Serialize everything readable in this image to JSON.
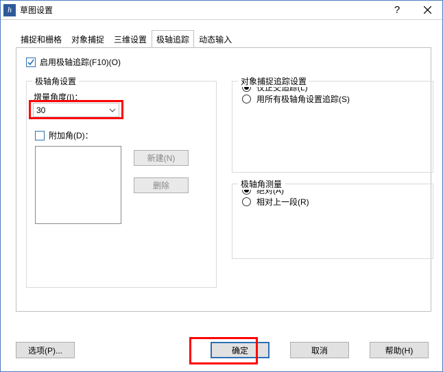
{
  "title": "草图设置",
  "titlebar": {
    "help": "?",
    "close": "×"
  },
  "tabs": [
    {
      "label": "捕捉和栅格"
    },
    {
      "label": "对象捕捉"
    },
    {
      "label": "三维设置"
    },
    {
      "label": "极轴追踪"
    },
    {
      "label": "动态输入"
    }
  ],
  "active_tab_index": 3,
  "enable_polar": {
    "checked": true,
    "label": "启用极轴追踪(F10)(O)"
  },
  "group_polar": {
    "legend": "极轴角设置",
    "increment_label": "增量角度(I)：",
    "increment_value": "30",
    "additional_label": "附加角(D)：",
    "additional_checked": false,
    "btn_new": "新建(N)",
    "btn_delete": "删除"
  },
  "group_osnap": {
    "legend": "对象捕捉追踪设置",
    "options": [
      {
        "label": "仅正交追踪(L)",
        "selected": true
      },
      {
        "label": "用所有极轴角设置追踪(S)",
        "selected": false
      }
    ]
  },
  "group_measure": {
    "legend": "极轴角测量",
    "options": [
      {
        "label": "绝对(A)",
        "selected": true
      },
      {
        "label": "相对上一段(R)",
        "selected": false
      }
    ]
  },
  "footer": {
    "options": "选项(P)...",
    "ok": "确定",
    "cancel": "取消",
    "help": "帮助(H)"
  }
}
